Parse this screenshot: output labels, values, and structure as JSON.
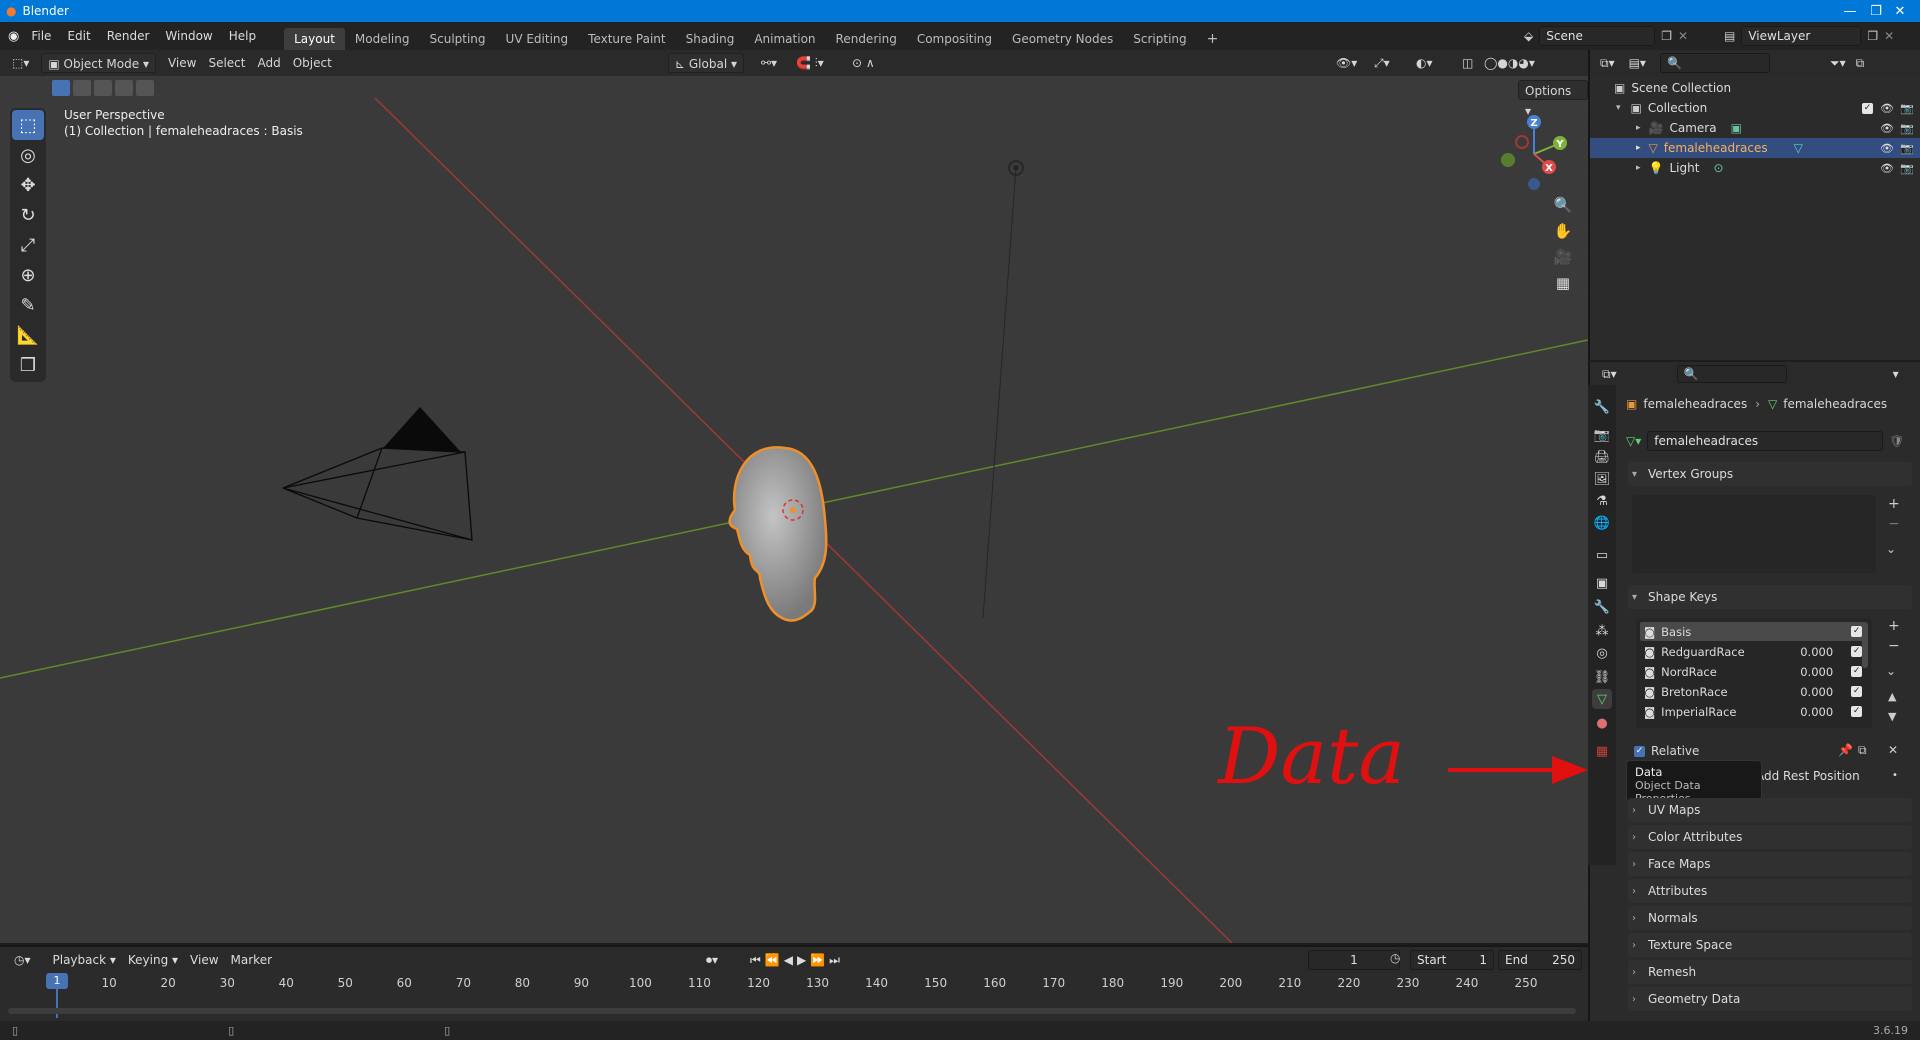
{
  "window": {
    "title": "Blender"
  },
  "menus": [
    "File",
    "Edit",
    "Render",
    "Window",
    "Help"
  ],
  "workspaces": [
    "Layout",
    "Modeling",
    "Sculpting",
    "UV Editing",
    "Texture Paint",
    "Shading",
    "Animation",
    "Rendering",
    "Compositing",
    "Geometry Nodes",
    "Scripting"
  ],
  "active_workspace": "Layout",
  "scene": {
    "name": "Scene",
    "view_layer": "ViewLayer"
  },
  "viewport": {
    "mode": "Object Mode",
    "menus": [
      "View",
      "Select",
      "Add",
      "Object"
    ],
    "orientation": "Global",
    "options_label": "Options",
    "overlay_title": "User Perspective",
    "overlay_subtitle": "(1) Collection | femaleheadraces : Basis",
    "gizmo": {
      "x": "X",
      "y": "Y",
      "z": "Z"
    }
  },
  "outliner": {
    "root": "Scene Collection",
    "collection": "Collection",
    "items": [
      {
        "name": "Camera",
        "selected": false
      },
      {
        "name": "femaleheadraces",
        "selected": true
      },
      {
        "name": "Light",
        "selected": false
      }
    ]
  },
  "properties": {
    "breadcrumb_object": "femaleheadraces",
    "breadcrumb_data": "femaleheadraces",
    "data_name": "femaleheadraces",
    "vertex_groups_label": "Vertex Groups",
    "shape_keys_label": "Shape Keys",
    "shape_keys": [
      {
        "name": "Basis",
        "value": "",
        "selected": true
      },
      {
        "name": "RedguardRace",
        "value": "0.000",
        "selected": false
      },
      {
        "name": "NordRace",
        "value": "0.000",
        "selected": false
      },
      {
        "name": "BretonRace",
        "value": "0.000",
        "selected": false
      },
      {
        "name": "ImperialRace",
        "value": "0.000",
        "selected": false
      }
    ],
    "relative_label": "Relative",
    "add_rest_label": "Add Rest Position",
    "tooltip": {
      "title": "Data",
      "desc": "Object Data Properties"
    },
    "collapsed_panels": [
      "UV Maps",
      "Color Attributes",
      "Face Maps",
      "Attributes",
      "Normals",
      "Texture Space",
      "Remesh",
      "Geometry Data"
    ]
  },
  "annotation": {
    "text": "Data",
    "color": "#e01010"
  },
  "timeline": {
    "menus": [
      "Playback",
      "Keying",
      "View",
      "Marker"
    ],
    "current_frame": "1",
    "start_label": "Start",
    "start_value": "1",
    "end_label": "End",
    "end_value": "250",
    "ticks": [
      "1",
      "10",
      "20",
      "30",
      "40",
      "50",
      "60",
      "70",
      "80",
      "90",
      "100",
      "110",
      "120",
      "130",
      "140",
      "150",
      "160",
      "170",
      "180",
      "190",
      "200",
      "210",
      "220",
      "230",
      "240",
      "250"
    ]
  },
  "status": {
    "version": "3.6.19"
  },
  "colors": {
    "accent": "#4772b3",
    "selection_outline": "#f0902a",
    "x_axis": "#a03838",
    "y_axis": "#5f8a2a"
  }
}
